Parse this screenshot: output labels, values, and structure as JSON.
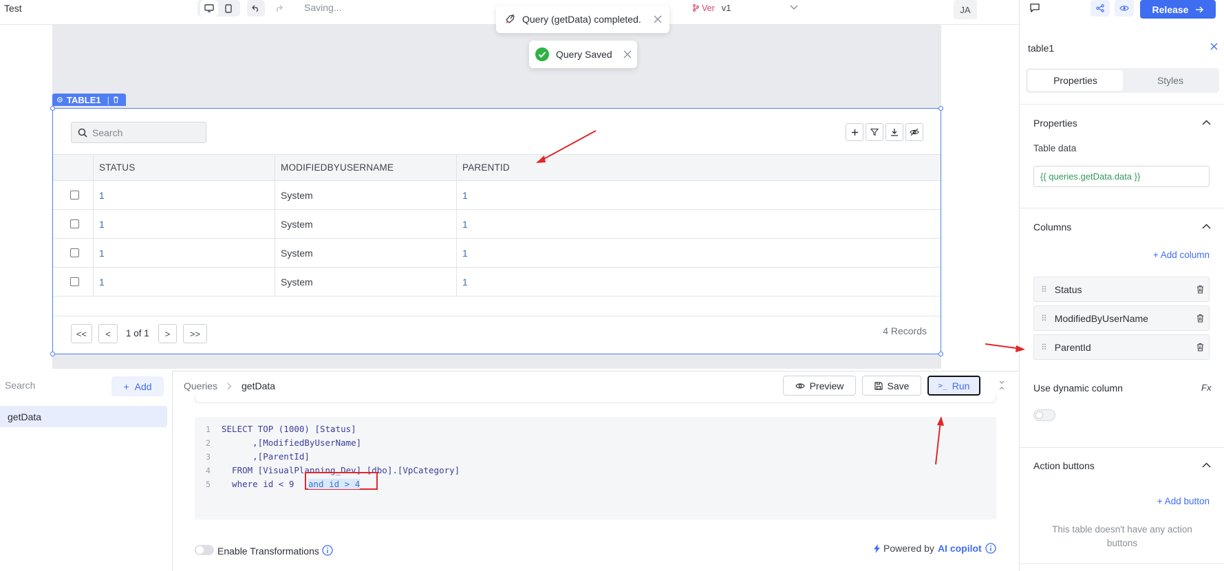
{
  "app": {
    "title": "Test",
    "saving_status": "Saving...",
    "version_prefix": "Ver",
    "version": "v1",
    "user_initials": "JA",
    "release_label": "Release"
  },
  "toasts": {
    "query_completed": "Query (getData) completed.",
    "query_saved": "Query Saved"
  },
  "table_widget": {
    "badge": "TABLE1",
    "search_placeholder": "Search",
    "columns": [
      "STATUS",
      "MODIFIEDBYUSERNAME",
      "PARENTID"
    ],
    "rows": [
      [
        "1",
        "System",
        "1"
      ],
      [
        "1",
        "System",
        "1"
      ],
      [
        "1",
        "System",
        "1"
      ],
      [
        "1",
        "System",
        "1"
      ]
    ],
    "pagination": {
      "first": "<<",
      "prev": "<",
      "page": "1 of 1",
      "next": ">",
      "last": ">>"
    },
    "records": "4 Records"
  },
  "query_panel": {
    "search_placeholder": "Search",
    "add_label": "Add",
    "queries": [
      "getData"
    ],
    "breadcrumb": {
      "root": "Queries",
      "current": "getData"
    },
    "preview_label": "Preview",
    "save_label": "Save",
    "run_label": "Run",
    "code_lines": [
      {
        "n": "1",
        "text": "SELECT TOP (1000) [Status]"
      },
      {
        "n": "2",
        "text": "      ,[ModifiedByUserName]"
      },
      {
        "n": "3",
        "text": "      ,[ParentId]"
      },
      {
        "n": "4",
        "text": "  FROM [VisualPlanning_Dev].[dbo].[VpCategory]"
      },
      {
        "n": "5",
        "text": "  where id < 9"
      }
    ],
    "code_highlight": "and id > 4",
    "enable_transformations": "Enable Transformations",
    "powered_by": "Powered by",
    "ai_copilot": "AI copilot"
  },
  "inspector": {
    "component_name": "table1",
    "tabs": [
      "Properties",
      "Styles"
    ],
    "properties_title": "Properties",
    "table_data_label": "Table data",
    "table_data_value": "{{ queries.getData.data }}",
    "columns_title": "Columns",
    "add_column": "+ Add column",
    "columns": [
      "Status",
      "ModifiedByUserName",
      "ParentId"
    ],
    "dynamic_column_label": "Use dynamic column",
    "fx_label": "Fx",
    "action_buttons_title": "Action buttons",
    "add_button": "+ Add button",
    "no_action_buttons": "This table doesn't have any action buttons"
  },
  "colors": {
    "accent": "#3e6df1",
    "canvas": "#e9eaee",
    "selection": "#4f7df3",
    "annotation_red": "#e3262a",
    "success": "#2fb344"
  }
}
